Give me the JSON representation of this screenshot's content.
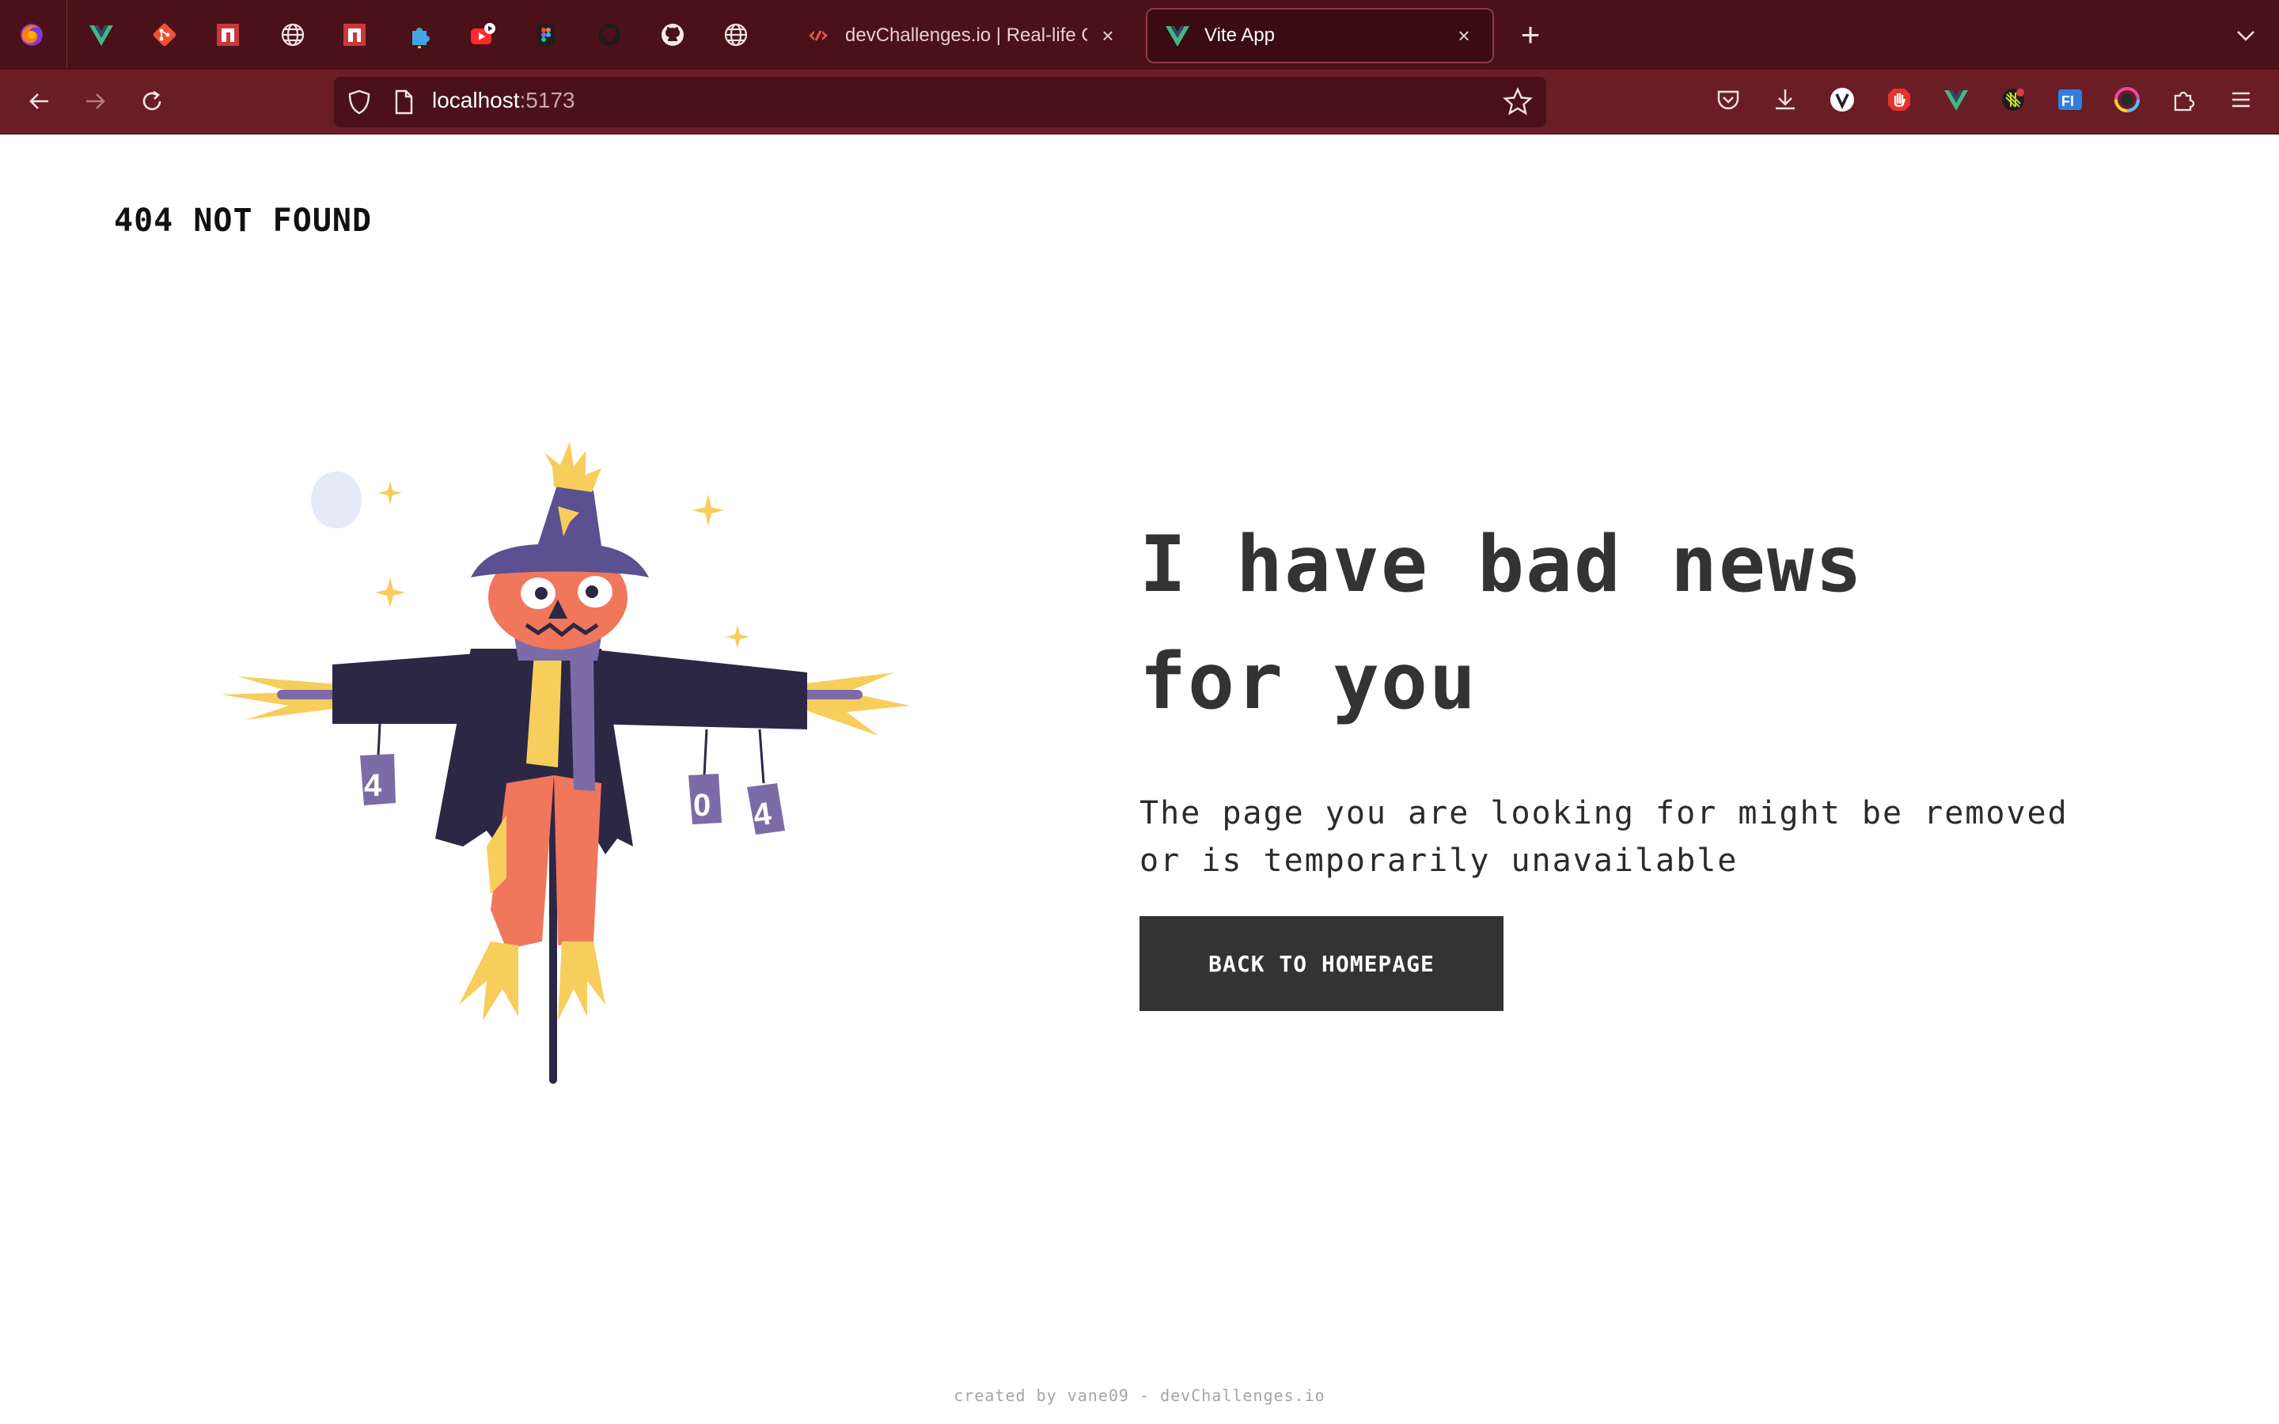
{
  "browser": {
    "pinned_tabs": [
      {
        "icon": "firefox-icon"
      },
      {
        "icon": "vue-icon"
      },
      {
        "icon": "git-icon"
      },
      {
        "icon": "npm-icon"
      },
      {
        "icon": "globe-icon"
      },
      {
        "icon": "npm-icon"
      },
      {
        "icon": "puzzle-extension-icon"
      },
      {
        "icon": "youtube-icon"
      },
      {
        "icon": "figma-icon"
      },
      {
        "icon": "github-icon"
      },
      {
        "icon": "github-icon"
      },
      {
        "icon": "globe-icon"
      }
    ],
    "tabs": [
      {
        "title": "devChallenges.io | Real-life Cod",
        "icon": "devchallenges-icon",
        "active": false
      },
      {
        "title": "Vite App",
        "icon": "vite-vue-icon",
        "active": true
      }
    ],
    "new_tab_glyph": "+",
    "close_glyph": "×",
    "address": {
      "host": "localhost",
      "port": ":5173"
    },
    "extensions": [
      "pocket-icon",
      "download-icon",
      "vimium-icon",
      "adblock-hand-icon",
      "vue-devtools-icon",
      "pattern-extension-icon",
      "fl-extension-icon",
      "color-picker-icon",
      "extensions-puzzle-icon",
      "menu-icon"
    ],
    "colors": {
      "tabbar": "#4a1118",
      "toolbar": "#6b1d25"
    }
  },
  "page": {
    "brand": "404 NOT FOUND",
    "headline": "I have bad news for you",
    "subtext": "The page you are looking for might be removed or is temporarily unavailable",
    "cta_label": "BACK TO HOMEPAGE",
    "footer": "created by vane09 - devChallenges.io",
    "illustration": {
      "subject": "scarecrow",
      "can_labels": [
        "4",
        "0",
        "4"
      ]
    },
    "colors": {
      "text": "#333333",
      "button_bg": "#333333",
      "button_text": "#ffffff"
    }
  }
}
